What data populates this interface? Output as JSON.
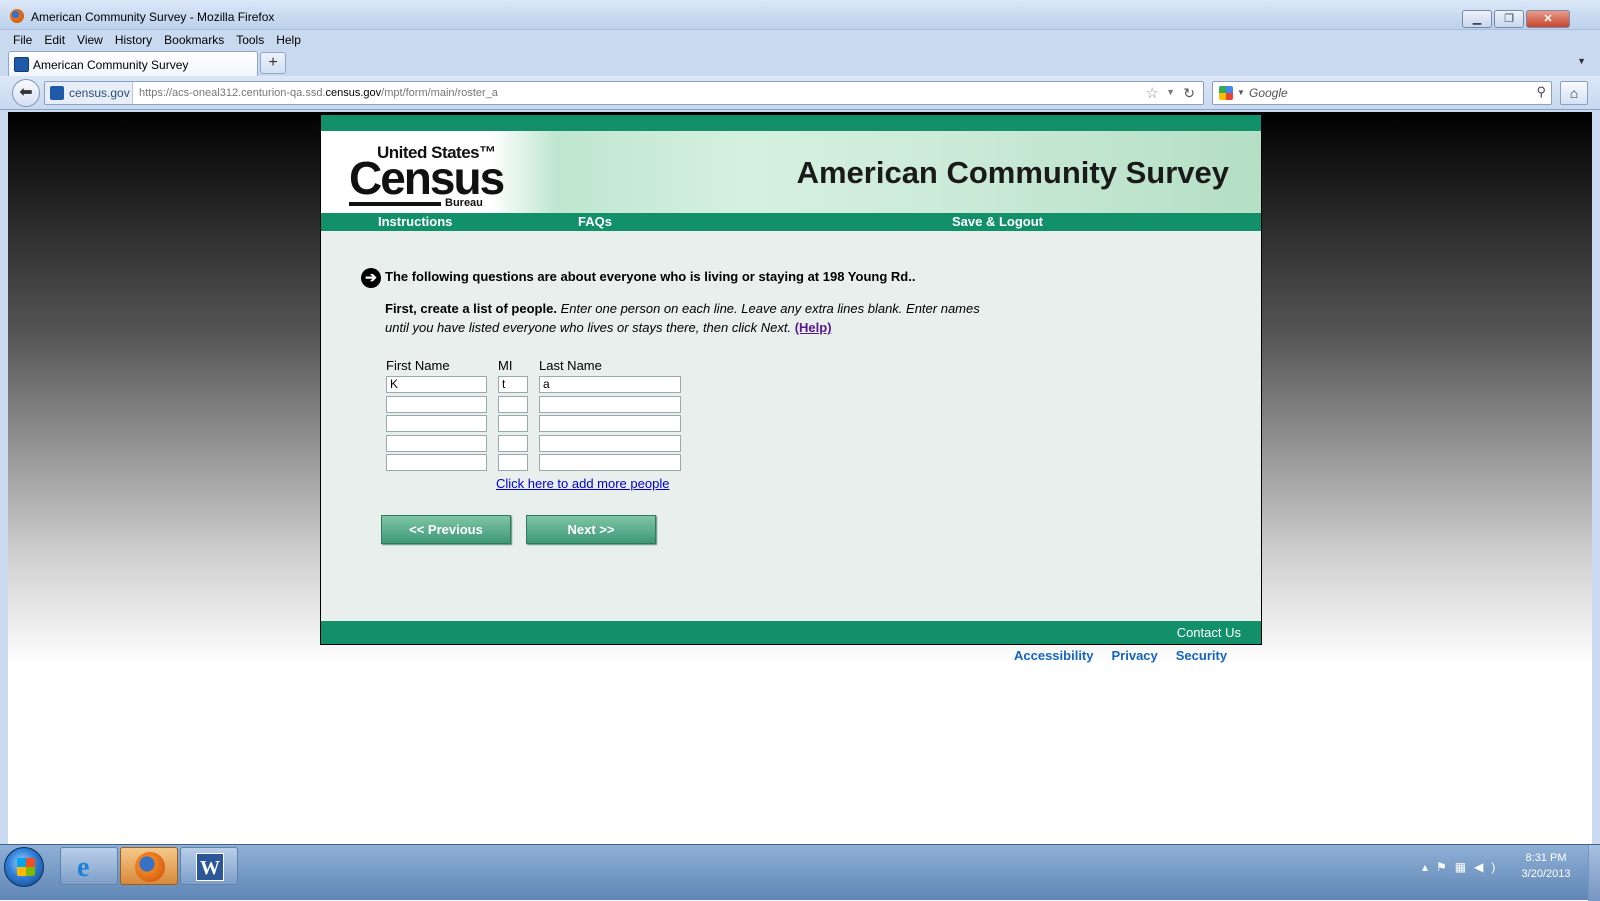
{
  "browser": {
    "window_title": "American Community Survey - Mozilla Firefox",
    "menu": [
      "File",
      "Edit",
      "View",
      "History",
      "Bookmarks",
      "Tools",
      "Help"
    ],
    "tab_label": "American Community Survey",
    "new_tab": "+",
    "site_identity": "census.gov",
    "url_prefix": "https://acs-oneal312.centurion-qa.ssd.",
    "url_domain": "census.gov",
    "url_suffix": "/mpt/form/main/roster_a",
    "search_placeholder": "Google",
    "window_buttons": {
      "minimize": "▁",
      "maximize": "❐",
      "close": "✕"
    }
  },
  "header": {
    "logo_line1": "United States™",
    "logo_census": "Census",
    "logo_bureau": "Bureau",
    "title": "American Community Survey"
  },
  "nav": {
    "instructions": "Instructions",
    "faqs": "FAQs",
    "save_logout": "Save & Logout"
  },
  "question": {
    "heading": "The following questions are about everyone who is living or staying at 198 Young Rd..",
    "lead": "First, create a list of people.",
    "body": "Enter one person on each line. Leave any extra lines blank. Enter names until you have listed everyone who lives or stays there, then click Next.",
    "help": "(Help)"
  },
  "roster": {
    "headers": {
      "first": "First Name",
      "mi": "MI",
      "last": "Last Name"
    },
    "rows": [
      {
        "first": "K",
        "mi": "t",
        "last": "a"
      },
      {
        "first": "",
        "mi": "",
        "last": ""
      },
      {
        "first": "",
        "mi": "",
        "last": ""
      },
      {
        "first": "",
        "mi": "",
        "last": ""
      },
      {
        "first": "",
        "mi": "",
        "last": ""
      }
    ],
    "add_more": "Click here to add more people"
  },
  "buttons": {
    "previous": "<<   Previous",
    "next": "Next   >>"
  },
  "footer": {
    "contact": "Contact Us",
    "links": [
      "Accessibility",
      "Privacy",
      "Security"
    ]
  },
  "taskbar": {
    "time": "8:31 PM",
    "date": "3/20/2013"
  }
}
